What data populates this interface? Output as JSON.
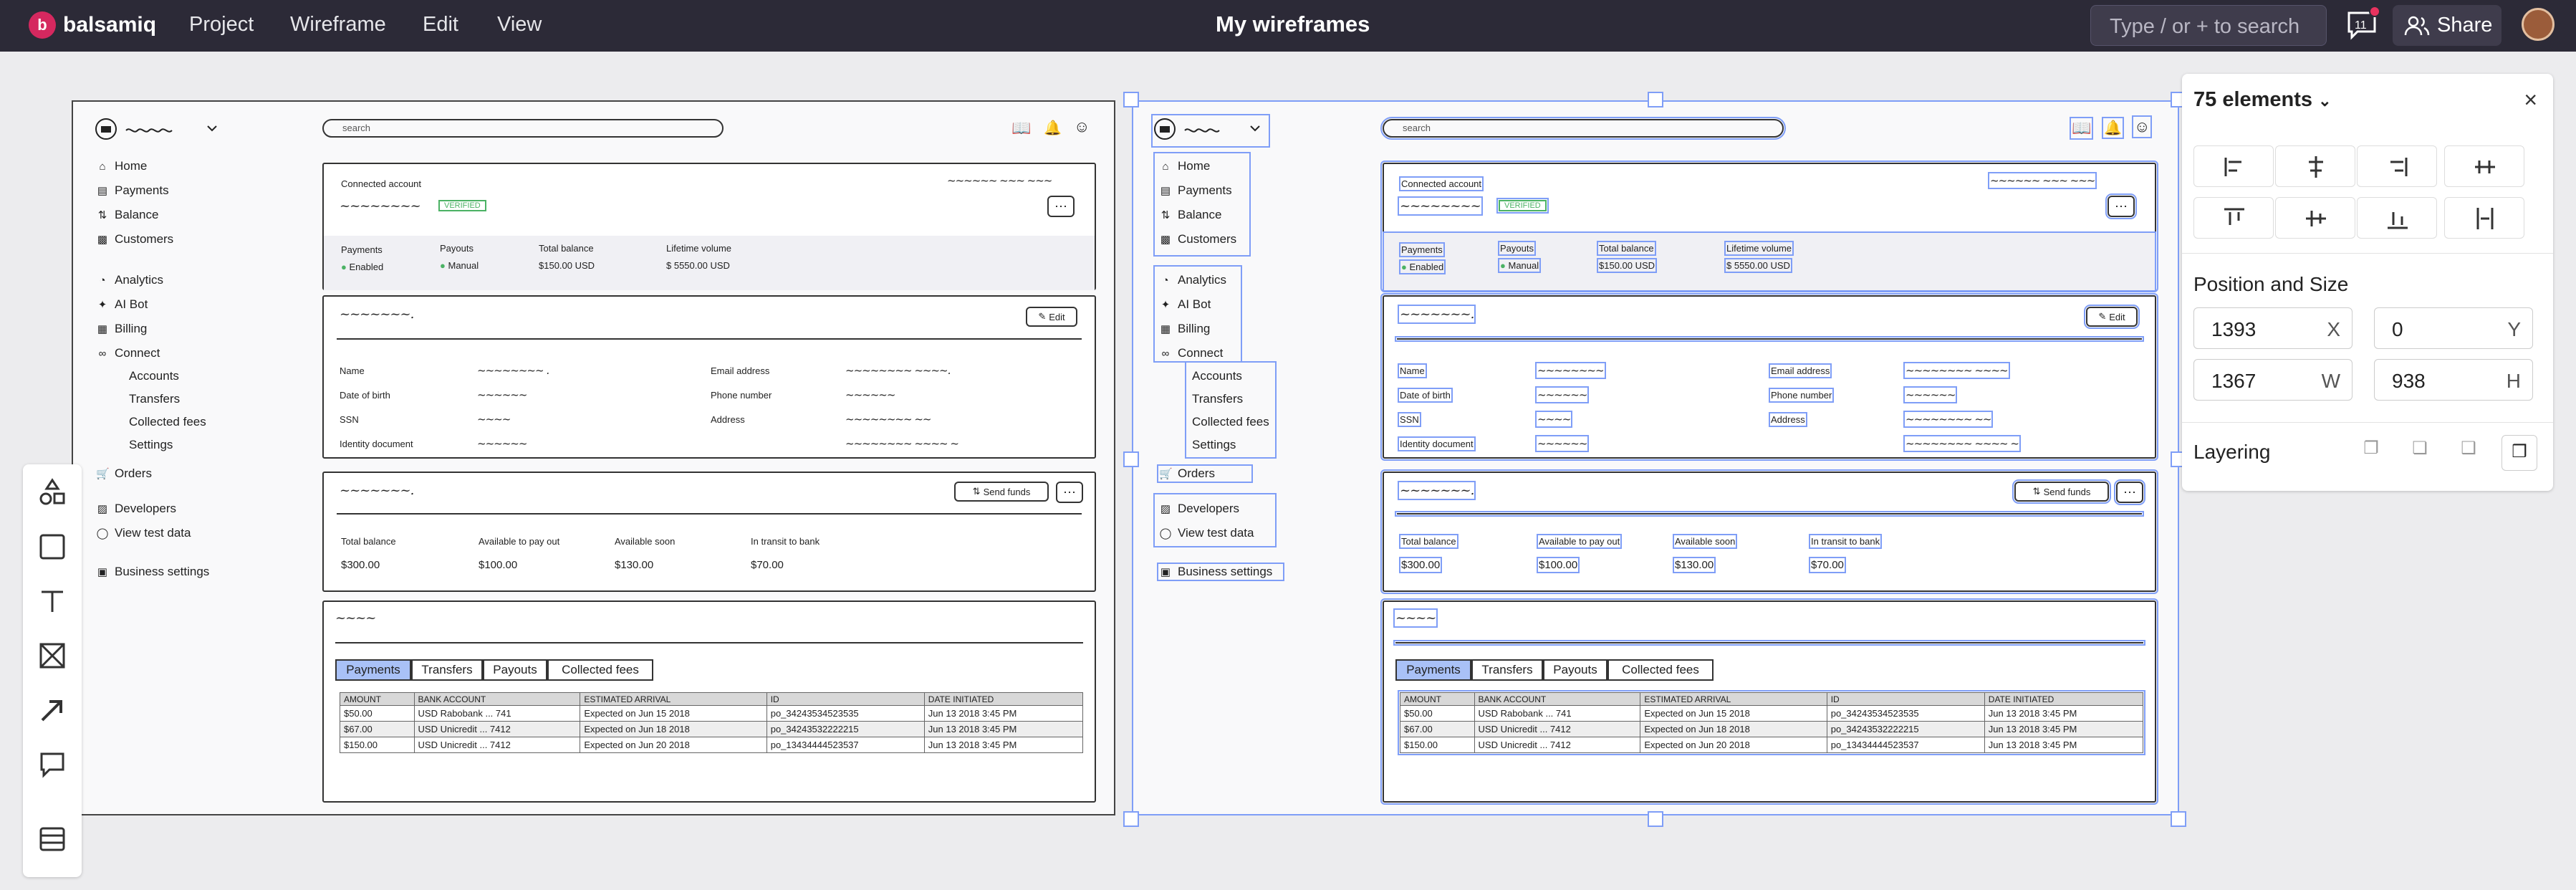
{
  "app": {
    "brand": "balsamiq",
    "menu": [
      "Project",
      "Wireframe",
      "Edit",
      "View"
    ],
    "doc_title": "My wireframes",
    "search_placeholder": "Type / or + to search",
    "notif_count": "11",
    "share_label": "Share"
  },
  "wireframe": {
    "search_placeholder": "search",
    "nav": [
      "Home",
      "Payments",
      "Balance",
      "Customers",
      "Analytics",
      "AI Bot",
      "Billing",
      "Connect",
      "Accounts",
      "Transfers",
      "Collected fees",
      "Settings",
      "Orders",
      "Developers",
      "View test data",
      "Business settings"
    ],
    "account": {
      "label": "Connected account",
      "badge": "VERIFIED",
      "stats": [
        {
          "label": "Payments",
          "value": "Enabled"
        },
        {
          "label": "Payouts",
          "value": "Manual"
        },
        {
          "label": "Total balance",
          "value": "$150.00 USD"
        },
        {
          "label": "Lifetime volume",
          "value": "$ 5550.00 USD"
        }
      ]
    },
    "edit_label": "Edit",
    "details": {
      "left": [
        "Name",
        "Date of birth",
        "SSN",
        "Identity document"
      ],
      "right": [
        "Email address",
        "Phone number",
        "Address"
      ]
    },
    "send_label": "Send funds",
    "balances": [
      {
        "label": "Total balance",
        "value": "$300.00"
      },
      {
        "label": "Available to pay out",
        "value": "$100.00"
      },
      {
        "label": "Available soon",
        "value": "$130.00"
      },
      {
        "label": "In transit to bank",
        "value": "$70.00"
      }
    ],
    "tabs": [
      "Payments",
      "Transfers",
      "Payouts",
      "Collected fees"
    ],
    "table": {
      "headers": [
        "AMOUNT",
        "BANK ACCOUNT",
        "ESTIMATED ARRIVAL",
        "ID",
        "DATE INITIATED"
      ],
      "rows": [
        [
          "$50.00",
          "USD Rabobank ... 741",
          "Expected on Jun 15 2018",
          "po_34243534523535",
          "Jun 13 2018 3:45 PM"
        ],
        [
          "$67.00",
          "USD Unicredit ... 7412",
          "Expected on Jun 18 2018",
          "po_34243532222215",
          "Jun 13 2018 3:45 PM"
        ],
        [
          "$150.00",
          "USD Unicredit ... 7412",
          "Expected on Jun 20 2018",
          "po_13434444523537",
          "Jun 13 2018 3:45 PM"
        ]
      ]
    }
  },
  "properties": {
    "title": "75 elements",
    "section_pos": "Position and Size",
    "x": "1393",
    "x_label": "X",
    "y": "0",
    "y_label": "Y",
    "w": "1367",
    "w_label": "W",
    "h": "938",
    "h_label": "H",
    "section_layer": "Layering"
  }
}
